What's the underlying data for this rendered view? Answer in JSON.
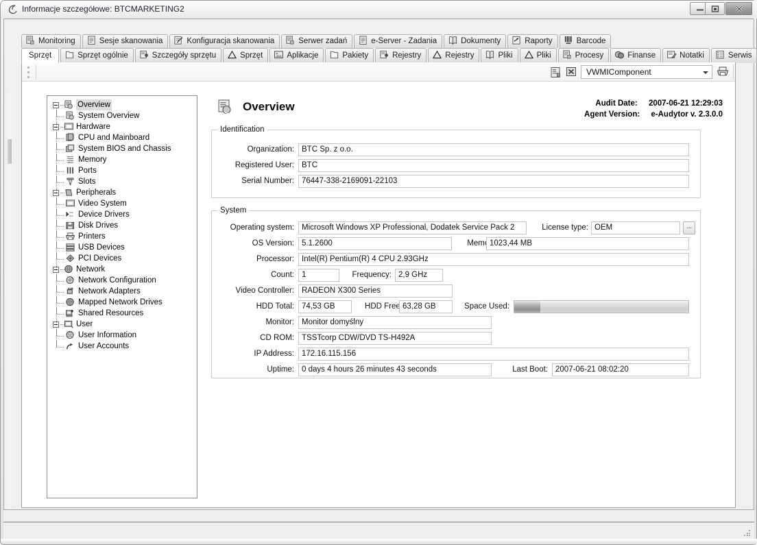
{
  "window": {
    "title": "Informacje szczegółowe: BTCMARKETING2",
    "title_icon": "app-swirl-icon",
    "controls": {
      "minimize": "minimize-icon",
      "maximize": "maximize-icon",
      "close": "close-icon"
    }
  },
  "tabs_row1": [
    {
      "label": "Monitoring",
      "icon": "report-hand-icon",
      "selected": false
    },
    {
      "label": "Sesje skanowania",
      "icon": "document-icon",
      "selected": false
    },
    {
      "label": "Konfiguracja skanowania",
      "icon": "checklist-icon",
      "selected": false
    },
    {
      "label": "Serwer zadań",
      "icon": "report-hand-icon",
      "selected": false
    },
    {
      "label": "e-Server - Zadania",
      "icon": "document-icon",
      "selected": false
    },
    {
      "label": "Dokumenty",
      "icon": "book-icon",
      "selected": false
    },
    {
      "label": "Raporty",
      "icon": "report-arrow-icon",
      "selected": false
    },
    {
      "label": "Barcode",
      "icon": "barcode-icon",
      "selected": false
    }
  ],
  "tabs_row2": [
    {
      "label": "Sprzęt",
      "icon": "",
      "selected": true
    },
    {
      "label": "Sprzęt ogólnie",
      "icon": "page-icon",
      "selected": false
    },
    {
      "label": "Szczegóły sprzętu",
      "icon": "page-gear-icon",
      "selected": false
    },
    {
      "label": "Sprzęt",
      "icon": "triangle-icon",
      "selected": false
    },
    {
      "label": "Aplikacje",
      "icon": "image-icon",
      "selected": false
    },
    {
      "label": "Pakiety",
      "icon": "page-icon",
      "selected": false
    },
    {
      "label": "Rejestry",
      "icon": "page-gear-icon",
      "selected": false
    },
    {
      "label": "Rejestry",
      "icon": "triangle-icon",
      "selected": false
    },
    {
      "label": "Pliki",
      "icon": "book-icon",
      "selected": false
    },
    {
      "label": "Pliki",
      "icon": "triangle-icon",
      "selected": false
    },
    {
      "label": "Procesy",
      "icon": "report-hand-icon",
      "selected": false
    },
    {
      "label": "Finanse",
      "icon": "coins-icon",
      "selected": false
    },
    {
      "label": "Notatki",
      "icon": "note-pencil-icon",
      "selected": false
    },
    {
      "label": "Serwis",
      "icon": "list-icon",
      "selected": false
    }
  ],
  "toolbar": {
    "grip": "drag-grip-icon",
    "icon_left": "properties-icon",
    "icon_excel": "excel-export-icon",
    "component_value": "VWMIComponent",
    "dropdown_arrow": "chevron-down-icon",
    "print_icon": "printer-icon"
  },
  "tree": [
    {
      "level": 0,
      "label": "Overview",
      "icon": "overview-icon",
      "expander": "minus",
      "selected": true
    },
    {
      "level": 1,
      "label": "System Overview",
      "icon": "overview-icon",
      "expander": "",
      "selected": false
    },
    {
      "level": 0,
      "label": "Hardware",
      "icon": "monitor-icon",
      "expander": "minus",
      "selected": false
    },
    {
      "level": 1,
      "label": "CPU and Mainboard",
      "icon": "cpu-icon",
      "expander": "",
      "selected": false
    },
    {
      "level": 1,
      "label": "System BIOS and Chassis",
      "icon": "chassis-icon",
      "expander": "",
      "selected": false
    },
    {
      "level": 1,
      "label": "Memory",
      "icon": "memory-icon",
      "expander": "",
      "selected": false
    },
    {
      "level": 1,
      "label": "Ports",
      "icon": "ports-icon",
      "expander": "",
      "selected": false
    },
    {
      "level": 1,
      "label": "Slots",
      "icon": "slots-icon",
      "expander": "",
      "selected": false
    },
    {
      "level": 0,
      "label": "Peripherals",
      "icon": "peripherals-icon",
      "expander": "minus",
      "selected": false
    },
    {
      "level": 1,
      "label": "Video System",
      "icon": "monitor-icon",
      "expander": "",
      "selected": false
    },
    {
      "level": 1,
      "label": "Device Drivers",
      "icon": "drivers-icon",
      "expander": "",
      "selected": false
    },
    {
      "level": 1,
      "label": "Disk Drives",
      "icon": "disk-icon",
      "expander": "",
      "selected": false
    },
    {
      "level": 1,
      "label": "Printers",
      "icon": "printer-icon",
      "expander": "",
      "selected": false
    },
    {
      "level": 1,
      "label": "USB Devices",
      "icon": "usb-icon",
      "expander": "",
      "selected": false
    },
    {
      "level": 1,
      "label": "PCI Devices",
      "icon": "pci-icon",
      "expander": "",
      "selected": false
    },
    {
      "level": 0,
      "label": "Network",
      "icon": "globe-icon",
      "expander": "minus",
      "selected": false
    },
    {
      "level": 1,
      "label": "Network Configuration",
      "icon": "network-config-icon",
      "expander": "",
      "selected": false
    },
    {
      "level": 1,
      "label": "Network Adapters",
      "icon": "nic-icon",
      "expander": "",
      "selected": false
    },
    {
      "level": 1,
      "label": "Mapped Network Drives",
      "icon": "globe-icon",
      "expander": "",
      "selected": false
    },
    {
      "level": 1,
      "label": "Shared Resources",
      "icon": "share-icon",
      "expander": "",
      "selected": false
    },
    {
      "level": 0,
      "label": "User",
      "icon": "user-card-icon",
      "expander": "minus",
      "selected": false
    },
    {
      "level": 1,
      "label": "User Information",
      "icon": "user-info-icon",
      "expander": "",
      "selected": false
    },
    {
      "level": 1,
      "label": "User Accounts",
      "icon": "user-accounts-icon",
      "expander": "",
      "selected": false
    }
  ],
  "detail": {
    "icon": "overview-icon",
    "title": "Overview",
    "meta": [
      {
        "label": "Audit Date:",
        "value": "2007-06-21 12:29:03"
      },
      {
        "label": "Agent Version:",
        "value": "e-Audytor  v. 2.3.0.0"
      }
    ],
    "identification": {
      "title": "Identification",
      "fields": [
        {
          "label": "Organization:",
          "value": "BTC Sp. z o.o."
        },
        {
          "label": "Registered User:",
          "value": "BTC"
        },
        {
          "label": "Serial Number:",
          "value": "76447-338-2169091-22103"
        }
      ]
    },
    "system": {
      "title": "System",
      "operating_system_label": "Operating system:",
      "operating_system": "Microsoft Windows XP Professional, Dodatek Service Pack 2",
      "license_type_label": "License type:",
      "license_type": "OEM",
      "license_browse": "...",
      "os_version_label": "OS Version:",
      "os_version": "5.1.2600",
      "memory_label": "Memory:",
      "memory": "1023,44 MB",
      "processor_label": "Processor:",
      "processor": "Intel(R) Pentium(R) 4 CPU 2.93GHz",
      "count_label": "Count:",
      "count": "1",
      "frequency_label": "Frequency:",
      "frequency": "2,9 GHz",
      "video_controller_label": "Video Controller:",
      "video_controller": "RADEON X300 Series",
      "hdd_total_label": "HDD Total:",
      "hdd_total": "74,53 GB",
      "hdd_free_label": "HDD Free:",
      "hdd_free": "63,28 GB",
      "space_used_label": "Space Used:",
      "space_used_percent": 15,
      "monitor_label": "Monitor:",
      "monitor": "Monitor domyślny",
      "cdrom_label": "CD ROM:",
      "cdrom": "TSSTcorp CDW/DVD TS-H492A",
      "ip_address_label": "IP Address:",
      "ip_address": "172.16.115.156",
      "uptime_label": "Uptime:",
      "uptime": "0 days 4 hours 26 minutes 43 seconds",
      "last_boot_label": "Last Boot:",
      "last_boot": "2007-06-21 08:02:20"
    }
  },
  "status": {
    "left": "",
    "right": "resize-grip-icon"
  },
  "colors": {
    "frame": "#9a9a9a",
    "panel": "#f0f0f0",
    "field_border": "#c3c3c3",
    "selection": "#dcdcdc"
  }
}
